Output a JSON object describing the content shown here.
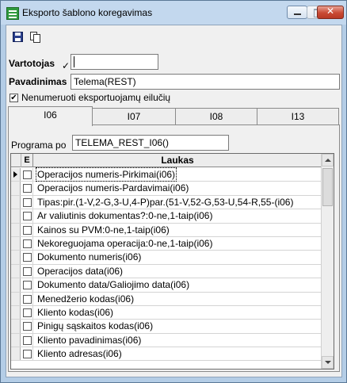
{
  "window": {
    "title": "Eksporto šablono koregavimas",
    "close_glyph": "✕"
  },
  "toolbar": {
    "save_icon": "floppy-disk-icon",
    "copy_icon": "copy-icon"
  },
  "form": {
    "user_label": "Vartotojas",
    "user_value": "",
    "name_label": "Pavadinimas",
    "name_value": "Telema(REST)",
    "no_numbering_label": "Nenumeruoti eksportuojamų eilučių",
    "no_numbering_checked": "✔"
  },
  "tabs": [
    {
      "label": "I06",
      "active": true
    },
    {
      "label": "I07",
      "active": false
    },
    {
      "label": "I08",
      "active": false
    },
    {
      "label": "I13",
      "active": false
    }
  ],
  "panel": {
    "program_label": "Programa po",
    "program_value": "TELEMA_REST_I06()"
  },
  "grid": {
    "col_e": "E",
    "col_field": "Laukas",
    "rows": [
      {
        "field": "Operacijos numeris-Pirkimai(i06)"
      },
      {
        "field": "Operacijos numeris-Pardavimai(i06)"
      },
      {
        "field": "Tipas:pir.(1-V,2-G,3-U,4-P)par.(51-V,52-G,53-U,54-R,55-(i06)"
      },
      {
        "field": "Ar valiutinis dokumentas?:0-ne,1-taip(i06)"
      },
      {
        "field": "Kainos su PVM:0-ne,1-taip(i06)"
      },
      {
        "field": "Nekoreguojama operacija:0-ne,1-taip(i06)"
      },
      {
        "field": "Dokumento numeris(i06)"
      },
      {
        "field": "Operacijos data(i06)"
      },
      {
        "field": "Dokumento data/Galiojimo data(i06)"
      },
      {
        "field": "Menedžerio kodas(i06)"
      },
      {
        "field": "Kliento kodas(i06)"
      },
      {
        "field": "Pinigų sąskaitos kodas(i06)"
      },
      {
        "field": "Kliento pavadinimas(i06)"
      },
      {
        "field": "Kliento adresas(i06)"
      }
    ]
  }
}
